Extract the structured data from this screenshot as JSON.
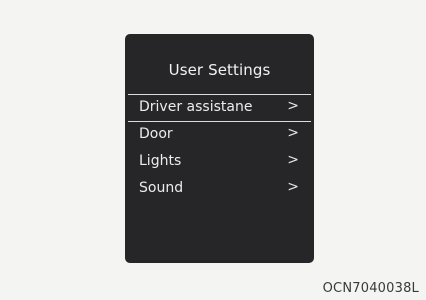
{
  "panel": {
    "title": "User Settings",
    "items": [
      {
        "label": "Driver assistane",
        "arrow": ">",
        "selected": true
      },
      {
        "label": "Door",
        "arrow": ">",
        "selected": false
      },
      {
        "label": "Lights",
        "arrow": ">",
        "selected": false
      },
      {
        "label": "Sound",
        "arrow": ">",
        "selected": false
      }
    ]
  },
  "figure_code": "OCN7040038L",
  "colors": {
    "background": "#f4f4f2",
    "panel": "#262628",
    "text": "#ececec",
    "selection_border": "#dcdcdc"
  }
}
